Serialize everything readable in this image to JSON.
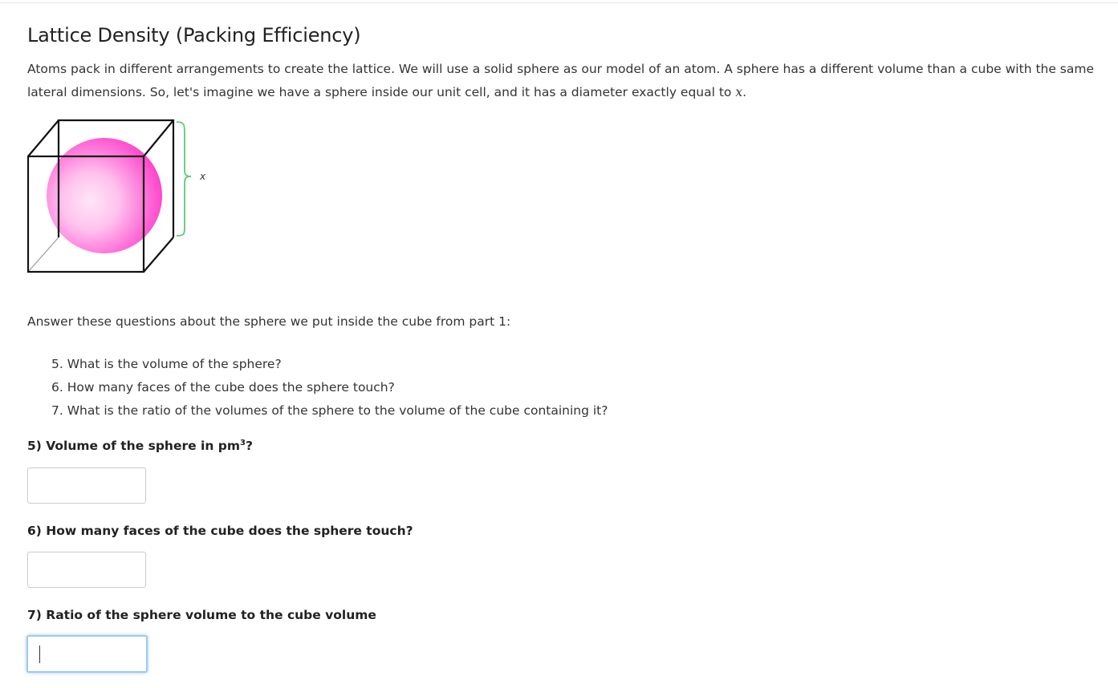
{
  "page": {
    "title": "Lattice Density (Packing Efficiency)",
    "intro": {
      "text": "Atoms pack in different arrangements to create the lattice. We will use a solid sphere as our model of an atom. A sphere has a different volume than a cube with the same lateral dimensions. So, let's imagine we have a sphere inside our unit cell, and it has a diameter exactly equal to ",
      "variable": "x",
      "end": "."
    },
    "figure": {
      "dimension_label": "x",
      "colors": {
        "sphere_core": "#ff33cc",
        "sphere_highlight": "#ffe3f8",
        "brace": "#5ec97a",
        "cube_edge": "#111111",
        "hidden_edge": "#9a9a9a"
      }
    },
    "prompt": "Answer these questions about the sphere we put inside the cube from part 1:",
    "questions": [
      "5. What is the volume of the sphere?",
      "6. How many faces of the cube does the sphere touch?",
      "7. What is the ratio of the volumes of the sphere to the volume of the cube containing it?"
    ],
    "answers": [
      {
        "label": "5) Volume of the sphere in pm",
        "sup": "3",
        "suffix": "?",
        "value": ""
      },
      {
        "label": "6) How many faces of the cube does the sphere touch?",
        "value": ""
      },
      {
        "label": "7) Ratio of the sphere volume to the cube volume",
        "value": ""
      }
    ]
  }
}
